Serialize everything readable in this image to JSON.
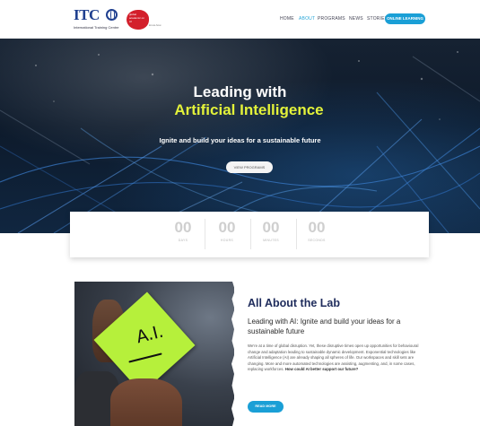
{
  "header": {
    "logo_text": "ITC",
    "logo_subtitle": "International Training Centre",
    "partner_badge_text": "global academic on AI",
    "partner_badge_side": "know-how",
    "nav": [
      {
        "label": "HOME"
      },
      {
        "label": "ABOUT"
      },
      {
        "label": "PROGRAMS"
      },
      {
        "label": "NEWS"
      },
      {
        "label": "STORIES"
      }
    ],
    "cta_label": "ONLINE LEARNING"
  },
  "hero": {
    "title_line1": "Leading with",
    "title_line2": "Artificial Intelligence",
    "subtitle": "Ignite and build your ideas for a sustainable future",
    "button_label": "VIEW PROGRAMS"
  },
  "countdown": [
    {
      "value": "00",
      "label": "DAYS"
    },
    {
      "value": "00",
      "label": "HOURS"
    },
    {
      "value": "00",
      "label": "MINUTES"
    },
    {
      "value": "00",
      "label": "SECONDS"
    }
  ],
  "about": {
    "sticky_text": "A.I.",
    "title": "All About the Lab",
    "subtitle": "Leading with AI: Ignite and build your ideas for a sustainable future",
    "body": "We're at a time of global disruption. Yet, these disruptive times open up opportunities for behavioural change and adaptation leading to sustainable dynamic development. Exponential technologies like Artificial Intelligence (AI) are already shaping all spheres of life. Our workspaces and skill sets are changing. More and more automated technologies are assisting, augmenting, and, in some cases, replacing workforces.",
    "body_bold": "How could AI better support our future?",
    "button_label": "READ MORE"
  },
  "colors": {
    "brand_blue": "#1f3f8f",
    "accent_cyan": "#1a9fd6",
    "hero_highlight": "#e3f23a",
    "badge_red": "#d31f2b"
  }
}
